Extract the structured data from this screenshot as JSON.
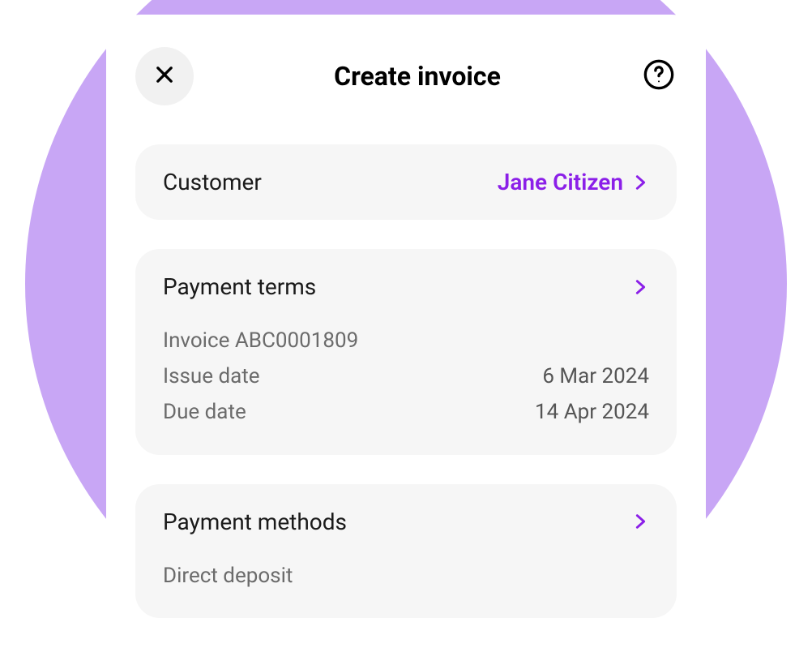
{
  "header": {
    "title": "Create invoice"
  },
  "customer": {
    "label": "Customer",
    "value": "Jane Citizen"
  },
  "payment_terms": {
    "title": "Payment terms",
    "invoice_number": "Invoice ABC0001809",
    "issue_label": "Issue date",
    "issue_value": "6 Mar 2024",
    "due_label": "Due date",
    "due_value": "14 Apr 2024"
  },
  "payment_methods": {
    "title": "Payment methods",
    "method": "Direct deposit"
  },
  "colors": {
    "accent": "#8b1fe8",
    "bg_circle": "#c8a6f5",
    "section_bg": "#f6f6f6"
  }
}
